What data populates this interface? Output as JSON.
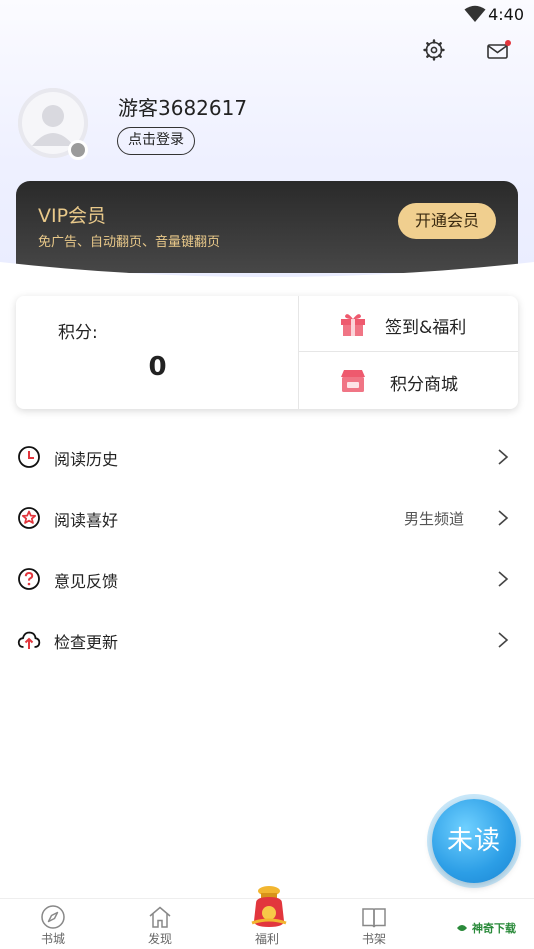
{
  "status_bar": {
    "time": "4:40"
  },
  "profile": {
    "username": "游客3682617",
    "login_label": "点击登录"
  },
  "vip": {
    "title": "VIP会员",
    "description": "免广告、自动翻页、音量键翻页",
    "button_label": "开通会员"
  },
  "points": {
    "label": "积分:",
    "value": "0",
    "checkin_label": "签到&福利",
    "store_label": "积分商城"
  },
  "menu": {
    "items": [
      {
        "label": "阅读历史",
        "value": "",
        "icon": "clock-icon"
      },
      {
        "label": "阅读喜好",
        "value": "男生频道",
        "icon": "flower-icon"
      },
      {
        "label": "意见反馈",
        "value": "",
        "icon": "question-icon"
      },
      {
        "label": "检查更新",
        "value": "",
        "icon": "cloud-upload-icon"
      }
    ]
  },
  "float_button": {
    "label": "未读"
  },
  "bottom_nav": {
    "items": [
      {
        "label": "书城",
        "icon": "compass-icon"
      },
      {
        "label": "发现",
        "icon": "home-icon"
      },
      {
        "label": "福利",
        "icon": "lucky-bag-icon"
      },
      {
        "label": "书架",
        "icon": "book-icon"
      }
    ]
  },
  "watermark": {
    "text": "神奇下载"
  },
  "colors": {
    "vip_gold": "#e9c98a",
    "vip_button": "#f0cf8f",
    "icon_red": "#e2363d",
    "float_blue": "#2c9ee6"
  }
}
